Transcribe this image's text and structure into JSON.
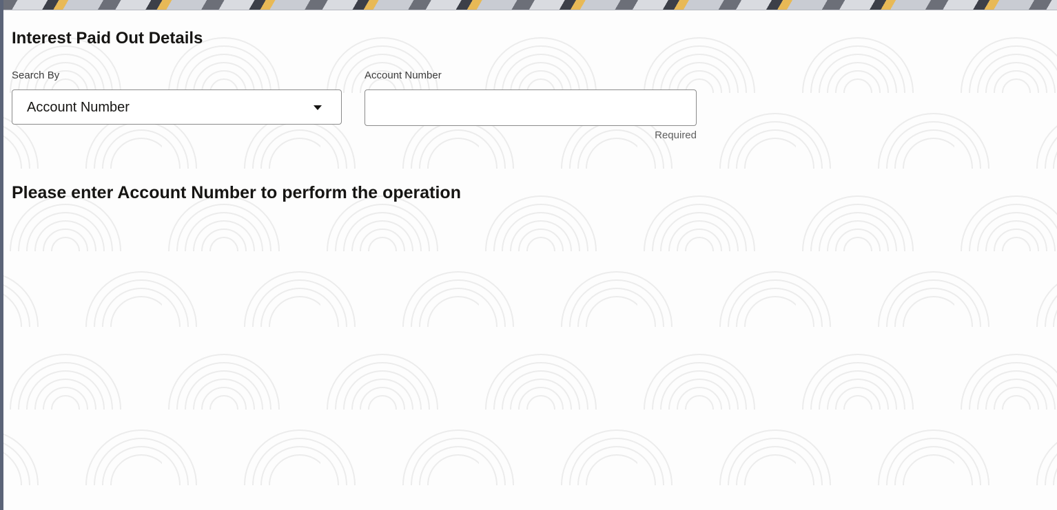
{
  "page": {
    "title": "Interest Paid Out Details",
    "message": "Please enter Account Number to perform the operation"
  },
  "search_by": {
    "label": "Search By",
    "selected": "Account Number",
    "icon": "caret-down-icon"
  },
  "account_number": {
    "label": "Account Number",
    "value": "",
    "placeholder": "",
    "hint": "Required"
  },
  "colors": {
    "rail": "#5b6478",
    "text": "#161513",
    "border": "#8a8a8a"
  }
}
